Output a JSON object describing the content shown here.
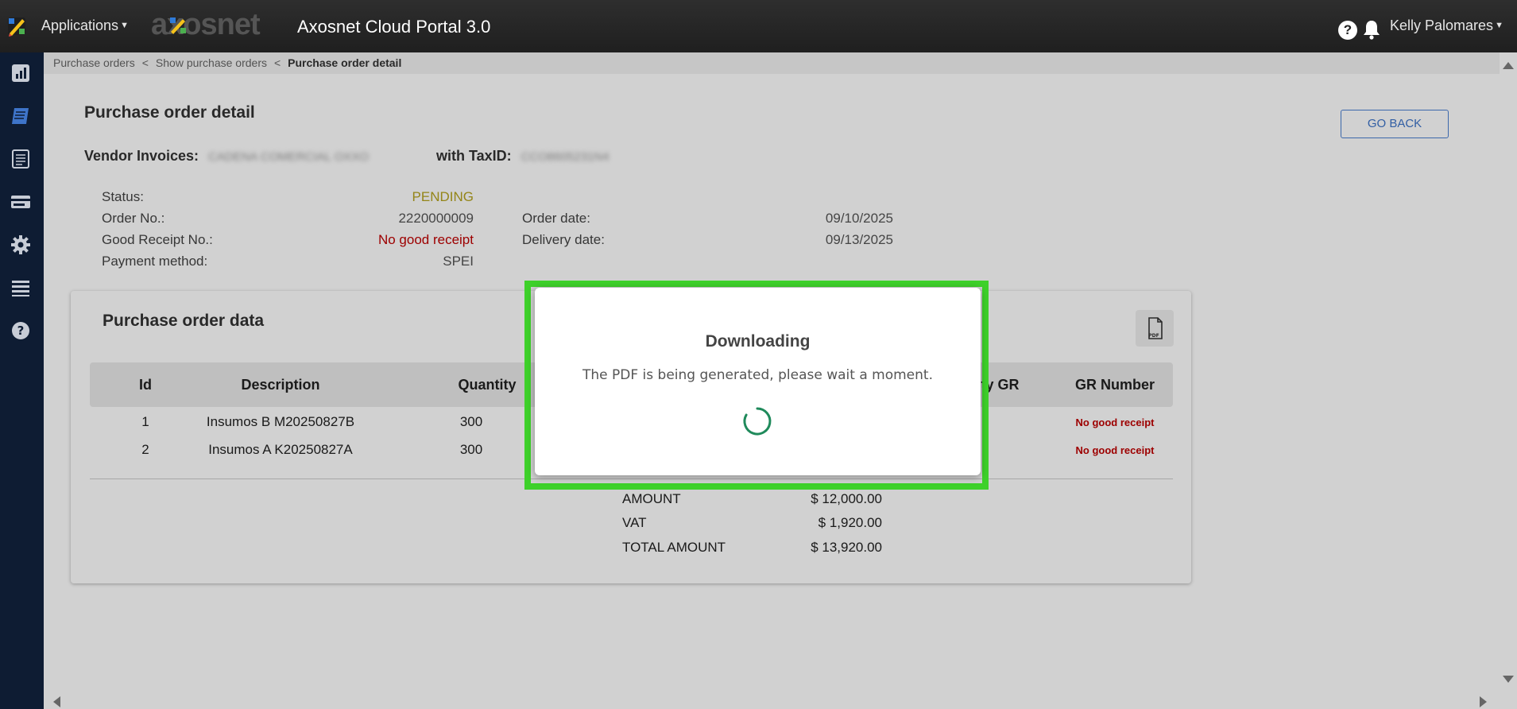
{
  "topbar": {
    "apps_label": "Applications",
    "brand_text": "axosnet",
    "portal_title": "Axosnet Cloud Portal 3.0",
    "help_glyph": "?",
    "user_name": "Kelly Palomares"
  },
  "sidebar": {
    "items": [
      "chart-icon",
      "invoice-icon",
      "document-icon",
      "card-icon",
      "gear-icon",
      "table-icon",
      "help-circle-icon"
    ]
  },
  "breadcrumb": {
    "items": [
      "Purchase orders",
      "Show purchase orders"
    ],
    "current": "Purchase order detail",
    "separator": "<"
  },
  "page": {
    "title": "Purchase order detail",
    "go_back_label": "GO BACK",
    "vendor_label": "Vendor Invoices:",
    "vendor_value": "CADENA COMERCIAL OXXO",
    "taxid_label": "with TaxID:",
    "taxid_value": "CCO8605231N4"
  },
  "info": {
    "status_label": "Status:",
    "status_value": "PENDING",
    "order_no_label": "Order No.:",
    "order_no_value": "2220000009",
    "order_date_label": "Order date:",
    "order_date_value": "09/10/2025",
    "gr_label": "Good Receipt No.:",
    "gr_value": "No good receipt",
    "delivery_label": "Delivery date:",
    "delivery_value": "09/13/2025",
    "payment_label": "Payment method:",
    "payment_value": "SPEI"
  },
  "card": {
    "title": "Purchase order data",
    "columns": {
      "id": "Id",
      "description": "Description",
      "quantity": "Quantity",
      "quantity_gr": "tity GR",
      "gr_number": "GR Number"
    },
    "rows": [
      {
        "id": "1",
        "description": "Insumos B M20250827B",
        "quantity": "300",
        "gr_number": "No good receipt"
      },
      {
        "id": "2",
        "description": "Insumos A K20250827A",
        "quantity": "300",
        "gr_number": "No good receipt"
      }
    ],
    "totals": {
      "amount_label": "AMOUNT",
      "amount_value": "$ 12,000.00",
      "vat_label": "VAT",
      "vat_value": "$ 1,920.00",
      "total_label": "TOTAL AMOUNT",
      "total_value": "$ 13,920.00"
    }
  },
  "modal": {
    "title": "Downloading",
    "message": "The PDF is being generated, please wait a moment."
  },
  "colors": {
    "topbar": "#262626",
    "sidebar": "#0e1c33",
    "status_pending": "#b5a31e",
    "no_receipt": "#c00000",
    "highlight": "#3ed12a",
    "spinner": "#1f8a5b",
    "go_back": "#3e74c9"
  }
}
